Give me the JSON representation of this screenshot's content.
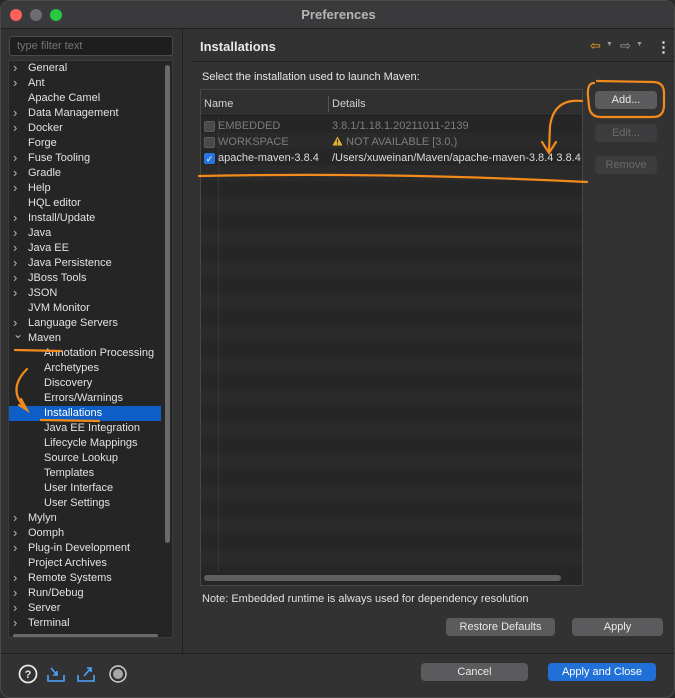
{
  "window": {
    "title": "Preferences"
  },
  "filter": {
    "placeholder": "type filter text"
  },
  "tree": [
    {
      "label": "General",
      "level": 0,
      "twisty": "closed"
    },
    {
      "label": "Ant",
      "level": 0,
      "twisty": "closed"
    },
    {
      "label": "Apache Camel",
      "level": 0,
      "twisty": "none"
    },
    {
      "label": "Data Management",
      "level": 0,
      "twisty": "closed"
    },
    {
      "label": "Docker",
      "level": 0,
      "twisty": "closed"
    },
    {
      "label": "Forge",
      "level": 0,
      "twisty": "none"
    },
    {
      "label": "Fuse Tooling",
      "level": 0,
      "twisty": "closed"
    },
    {
      "label": "Gradle",
      "level": 0,
      "twisty": "closed"
    },
    {
      "label": "Help",
      "level": 0,
      "twisty": "closed"
    },
    {
      "label": "HQL editor",
      "level": 0,
      "twisty": "none"
    },
    {
      "label": "Install/Update",
      "level": 0,
      "twisty": "closed"
    },
    {
      "label": "Java",
      "level": 0,
      "twisty": "closed"
    },
    {
      "label": "Java EE",
      "level": 0,
      "twisty": "closed"
    },
    {
      "label": "Java Persistence",
      "level": 0,
      "twisty": "closed"
    },
    {
      "label": "JBoss Tools",
      "level": 0,
      "twisty": "closed"
    },
    {
      "label": "JSON",
      "level": 0,
      "twisty": "closed"
    },
    {
      "label": "JVM Monitor",
      "level": 0,
      "twisty": "none"
    },
    {
      "label": "Language Servers",
      "level": 0,
      "twisty": "closed"
    },
    {
      "label": "Maven",
      "level": 0,
      "twisty": "open"
    },
    {
      "label": "Annotation Processing",
      "level": 1,
      "twisty": "none"
    },
    {
      "label": "Archetypes",
      "level": 1,
      "twisty": "none"
    },
    {
      "label": "Discovery",
      "level": 1,
      "twisty": "none"
    },
    {
      "label": "Errors/Warnings",
      "level": 1,
      "twisty": "none"
    },
    {
      "label": "Installations",
      "level": 1,
      "twisty": "none",
      "selected": true
    },
    {
      "label": "Java EE Integration",
      "level": 1,
      "twisty": "none"
    },
    {
      "label": "Lifecycle Mappings",
      "level": 1,
      "twisty": "none"
    },
    {
      "label": "Source Lookup",
      "level": 1,
      "twisty": "none"
    },
    {
      "label": "Templates",
      "level": 1,
      "twisty": "none"
    },
    {
      "label": "User Interface",
      "level": 1,
      "twisty": "none"
    },
    {
      "label": "User Settings",
      "level": 1,
      "twisty": "none"
    },
    {
      "label": "Mylyn",
      "level": 0,
      "twisty": "closed"
    },
    {
      "label": "Oomph",
      "level": 0,
      "twisty": "closed"
    },
    {
      "label": "Plug-in Development",
      "level": 0,
      "twisty": "closed"
    },
    {
      "label": "Project Archives",
      "level": 0,
      "twisty": "none"
    },
    {
      "label": "Remote Systems",
      "level": 0,
      "twisty": "closed"
    },
    {
      "label": "Run/Debug",
      "level": 0,
      "twisty": "closed"
    },
    {
      "label": "Server",
      "level": 0,
      "twisty": "closed"
    },
    {
      "label": "Terminal",
      "level": 0,
      "twisty": "closed"
    }
  ],
  "page": {
    "title": "Installations",
    "prompt": "Select the installation used to launch Maven:",
    "columns": {
      "name": "Name",
      "details": "Details"
    },
    "installations": [
      {
        "name": "EMBEDDED",
        "details": "3.8.1/1.18.1.20211011-2139",
        "checked": false,
        "enabled": false,
        "warning": false
      },
      {
        "name": "WORKSPACE",
        "details": "NOT AVAILABLE [3.0,)",
        "checked": false,
        "enabled": false,
        "warning": true
      },
      {
        "name": "apache-maven-3.8.4",
        "details": "/Users/xuweinan/Maven/apache-maven-3.8.4 3.8.4",
        "checked": true,
        "enabled": true,
        "warning": false
      }
    ],
    "buttons": {
      "add": "Add...",
      "edit": "Edit...",
      "remove": "Remove"
    },
    "note": "Note: Embedded runtime is always used for dependency resolution",
    "restore_defaults": "Restore Defaults",
    "apply": "Apply"
  },
  "footer": {
    "cancel": "Cancel",
    "apply_close": "Apply and Close",
    "icons": [
      "help-icon",
      "import-icon",
      "export-icon",
      "record-icon"
    ]
  },
  "colors": {
    "annotation": "#f28a1c",
    "selection": "#0d5fc7",
    "primary_button": "#2170d8"
  }
}
